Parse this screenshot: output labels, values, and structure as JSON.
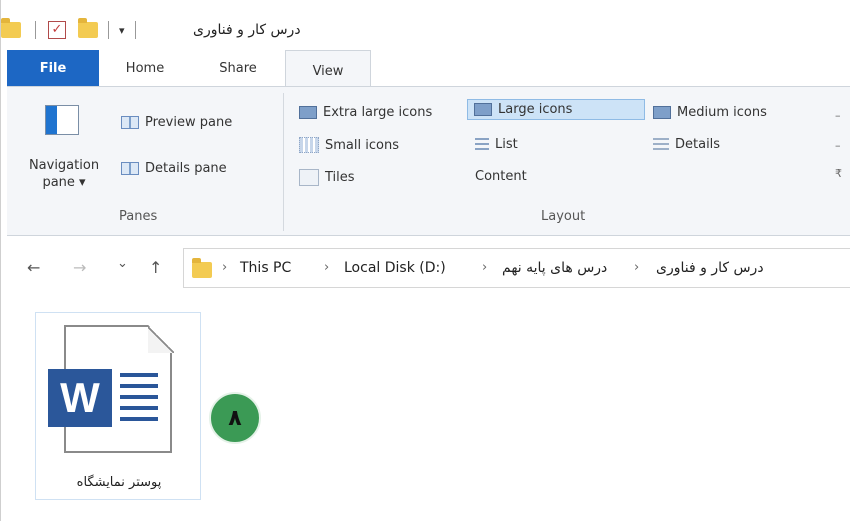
{
  "window": {
    "title": "درس کار و فناوری"
  },
  "quick_access": {
    "icons": [
      "folder-icon",
      "properties-check-icon",
      "folder-icon",
      "customize-dropdown-icon"
    ]
  },
  "tabs": [
    {
      "label": "File"
    },
    {
      "label": "Home"
    },
    {
      "label": "Share"
    },
    {
      "label": "View"
    }
  ],
  "ribbon": {
    "panes": {
      "navigation_pane_label": "Navigation pane ▾",
      "preview_pane_label": "Preview pane",
      "details_pane_label": "Details pane",
      "group_label": "Panes"
    },
    "layout": {
      "group_label": "Layout",
      "options": [
        {
          "label": "Extra large icons",
          "icon": "extra-large-icons-icon"
        },
        {
          "label": "Large icons",
          "icon": "large-icons-icon",
          "selected": true
        },
        {
          "label": "Medium icons",
          "icon": "medium-icons-icon"
        },
        {
          "label": "Small icons",
          "icon": "small-icons-icon"
        },
        {
          "label": "List",
          "icon": "list-icon"
        },
        {
          "label": "Details",
          "icon": "details-icon"
        },
        {
          "label": "Tiles",
          "icon": "tiles-icon"
        },
        {
          "label": "Content",
          "icon": "content-icon"
        }
      ]
    }
  },
  "navigation": {
    "back_glyph": "←",
    "forward_glyph": "→",
    "recent_glyph": "⌄",
    "up_glyph": "↑",
    "breadcrumb": [
      "This PC",
      "Local Disk (D:)",
      "درس های پایه نهم",
      "درس کار و فناوری"
    ]
  },
  "files": [
    {
      "name": "پوستر نمایشگاه",
      "icon": "word-document-icon",
      "badge_text": "W"
    }
  ],
  "annotation": {
    "step_number": "۸"
  },
  "colors": {
    "file_tab": "#1d67c4",
    "word_blue": "#2b579a",
    "step_badge": "#3b9a55",
    "selected_layout": "#cde3f7"
  }
}
